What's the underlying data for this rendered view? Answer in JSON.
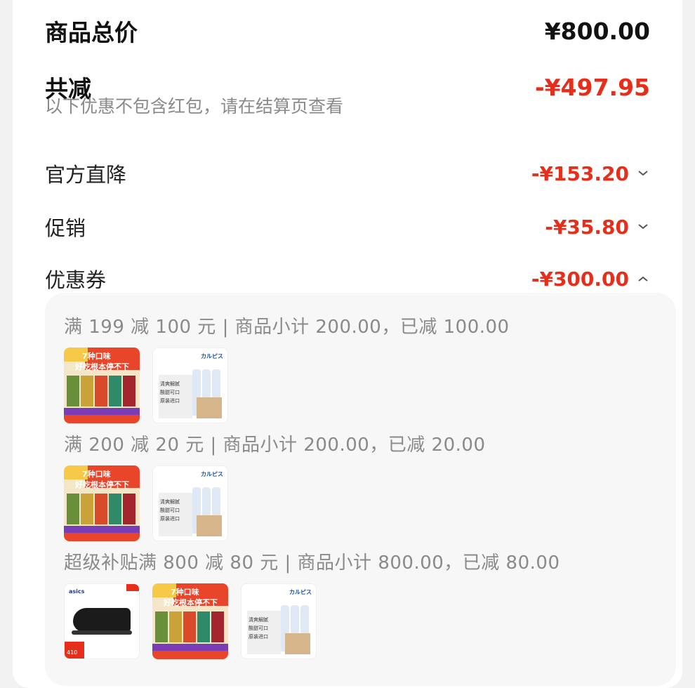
{
  "summary": {
    "total_label": "商品总价",
    "total_amount": "¥800.00",
    "discount_label": "共减",
    "discount_amount": "-¥497.95",
    "note": "以下优惠不包含红包，请在结算页查看"
  },
  "breakdown": [
    {
      "label": "官方直降",
      "amount": "-¥153.20",
      "state": "collapsed"
    },
    {
      "label": "促销",
      "amount": "-¥35.80",
      "state": "collapsed"
    },
    {
      "label": "优惠券",
      "amount": "-¥300.00",
      "state": "expanded"
    }
  ],
  "coupons": [
    {
      "text": "满 199 减 100 元 | 商品小计 200.00，已减 100.00"
    },
    {
      "text": "满 200 减 20 元 | 商品小计 200.00，已减 20.00"
    },
    {
      "text": "超级补贴满 800 减 80 元 | 商品小计 800.00，已减 80.00"
    }
  ],
  "products": {
    "food_banner_line1": "7种口味",
    "food_banner_line2": "好吃根本停不下",
    "water_logo": "カルピス",
    "shoe_brand": "asics",
    "shoe_price": "410"
  },
  "colors": {
    "accent": "#e62e1a",
    "muted": "#8a8a8a"
  },
  "icons": {
    "collapsed": "chevron-down-icon",
    "expanded": "chevron-up-icon"
  }
}
